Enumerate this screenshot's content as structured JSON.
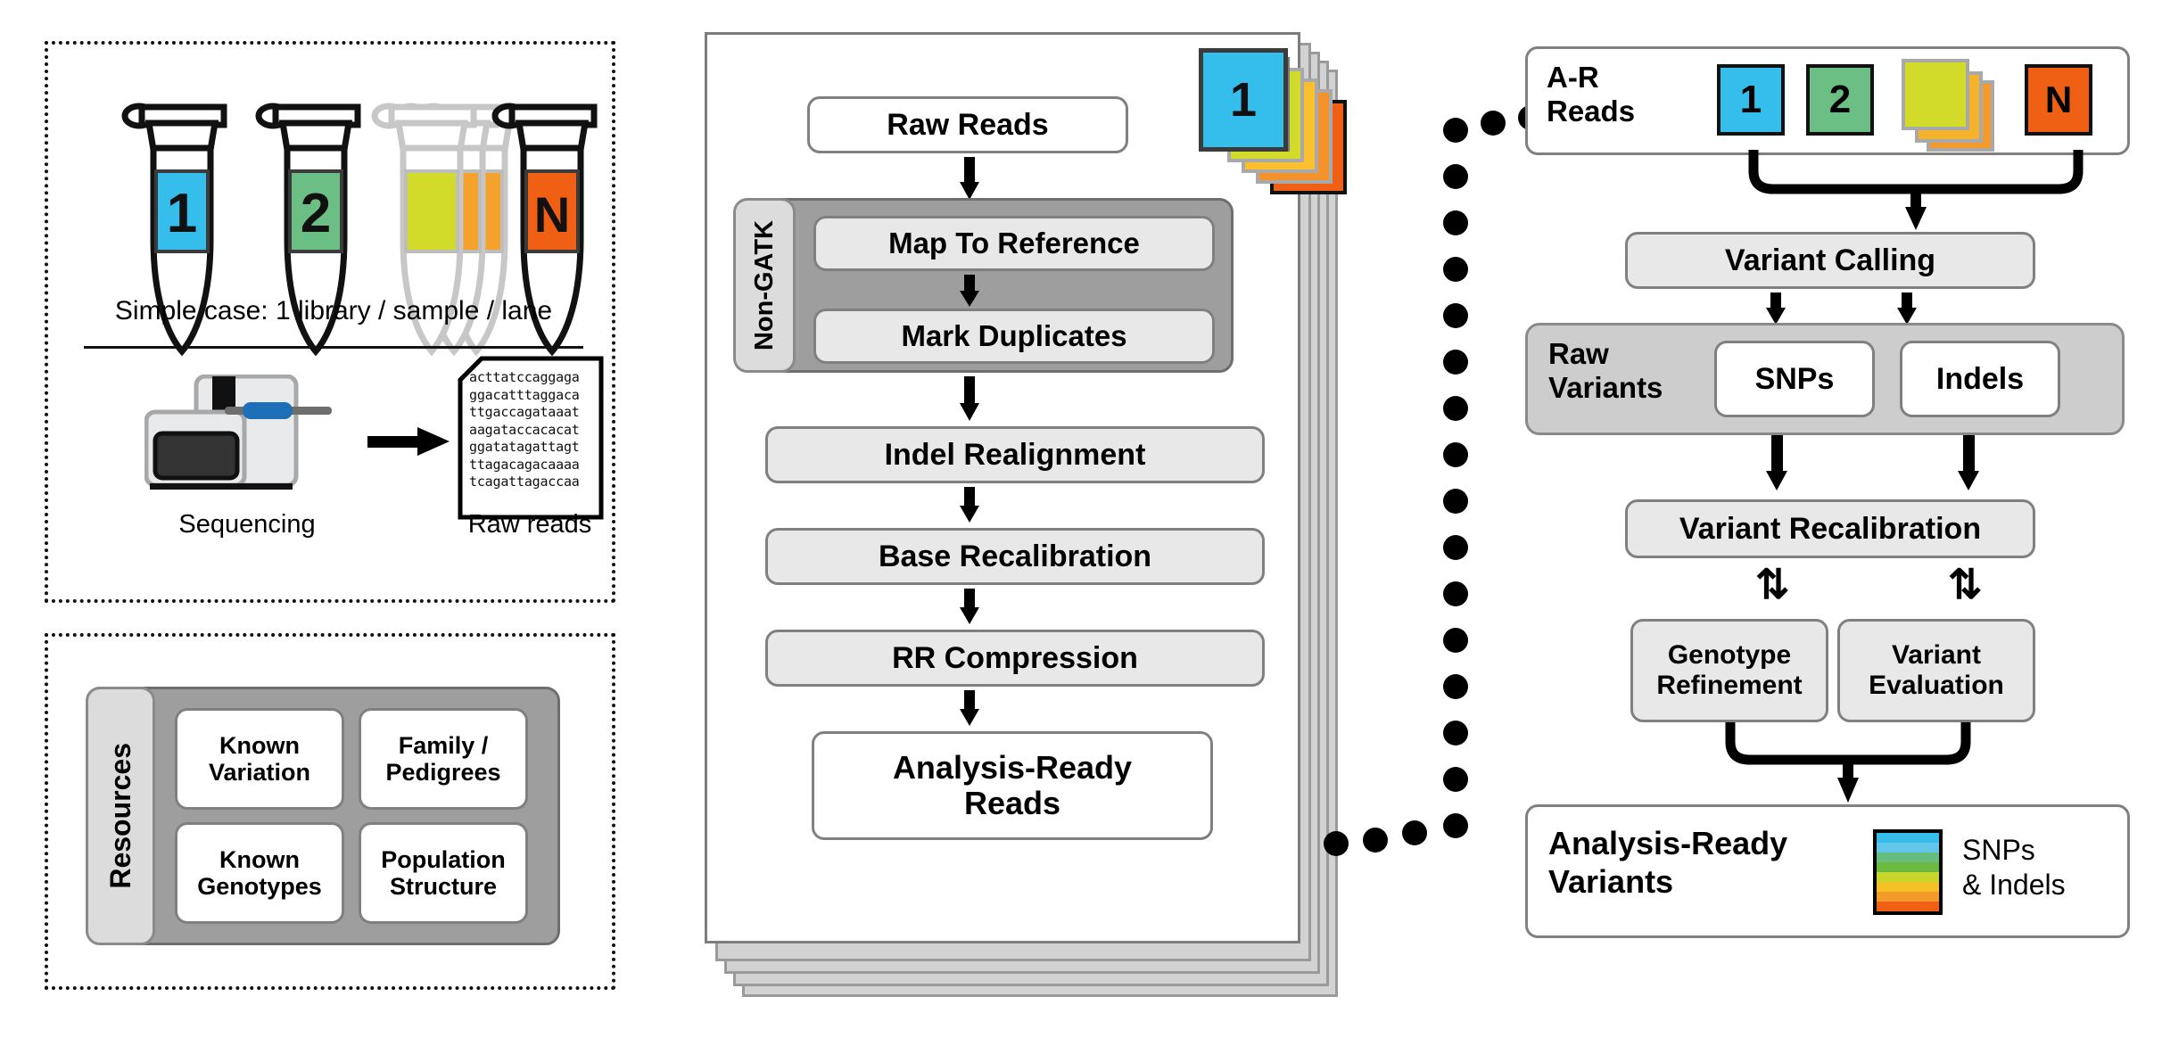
{
  "left_panel": {
    "tubes": [
      {
        "label": "1",
        "color": "#35bdec",
        "faded": false
      },
      {
        "label": "2",
        "color": "#6cbf84",
        "faded": false
      },
      {
        "label": "",
        "color": "#d2da2a",
        "faded": true
      },
      {
        "label": "",
        "color": "#f5a22c",
        "faded": true
      },
      {
        "label": "N",
        "color": "#ef6014",
        "faded": false
      }
    ],
    "caption": "Simple case: 1 library / sample / lane",
    "sequencing_label": "Sequencing",
    "raw_reads_label": "Raw reads",
    "sequence_lines": [
      "acttatccaggaga",
      "ggacatttaggaca",
      "ttgaccagataaat",
      "aagataccacacat",
      "ggatatagattagt",
      "ttagacagacaaaa",
      "tcagattagaccaa"
    ]
  },
  "resources_panel": {
    "group_label": "Resources",
    "items": [
      {
        "line1": "Known",
        "line2": "Variation"
      },
      {
        "line1": "Family /",
        "line2": "Pedigrees"
      },
      {
        "line1": "Known",
        "line2": "Genotypes"
      },
      {
        "line1": "Population",
        "line2": "Structure"
      }
    ]
  },
  "center_panel": {
    "raw_reads": "Raw Reads",
    "non_gatk_label": "Non-GATK",
    "non_gatk_steps": [
      "Map To Reference",
      "Mark Duplicates"
    ],
    "steps": [
      "Indel Realignment",
      "Base Recalibration",
      "RR Compression"
    ],
    "output_line1": "Analysis-Ready",
    "output_line2": "Reads",
    "stack_tab_label": "1",
    "stack_tab_colors": [
      "#35bdec",
      "#6cbf84",
      "#d2da2a",
      "#fbc02d",
      "#f5922c",
      "#ef6014"
    ]
  },
  "right_panel": {
    "ar_reads_line1": "A-R",
    "ar_reads_line2": "Reads",
    "ar_chips": [
      {
        "label": "1",
        "color": "#35bdec"
      },
      {
        "label": "2",
        "color": "#6cbf84"
      },
      {
        "label": "",
        "color": "#d2da2a"
      },
      {
        "label": "",
        "color": "#f5b22c"
      },
      {
        "label": "",
        "color": "#f59a2c"
      },
      {
        "label": "N",
        "color": "#ef6014"
      }
    ],
    "variant_calling": "Variant Calling",
    "raw_variants_line1": "Raw",
    "raw_variants_line2": "Variants",
    "snps": "SNPs",
    "indels": "Indels",
    "variant_recalibration": "Variant Recalibration",
    "genotype_refinement_line1": "Genotype",
    "genotype_refinement_line2": "Refinement",
    "variant_evaluation_line1": "Variant",
    "variant_evaluation_line2": "Evaluation",
    "arv_line1": "Analysis-Ready",
    "arv_line2": "Variants",
    "legend_line1": "SNPs",
    "legend_line2": "& Indels",
    "legend_colors": [
      "#35bdec",
      "#63c6e8",
      "#65bd7e",
      "#6cb93f",
      "#c6d62b",
      "#f4c226",
      "#f29a2a",
      "#ef6014"
    ],
    "bidir_glyph": "⇅"
  }
}
